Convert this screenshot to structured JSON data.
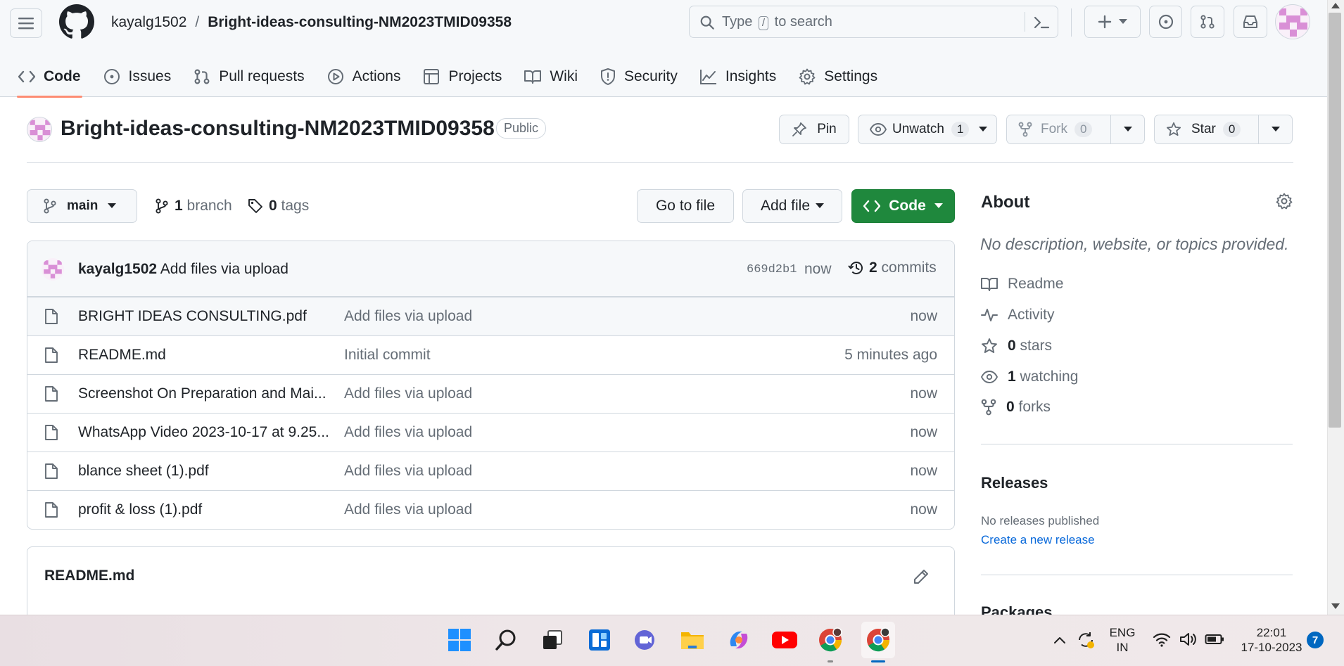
{
  "header": {
    "owner": "kayalg1502",
    "separator": "/",
    "repo": "Bright-ideas-consulting-NM2023TMID09358",
    "search_prefix": "Type",
    "search_key": "/",
    "search_suffix": "to search"
  },
  "tabs": [
    {
      "label": "Code",
      "icon": "code-icon",
      "selected": true
    },
    {
      "label": "Issues",
      "icon": "issue-icon"
    },
    {
      "label": "Pull requests",
      "icon": "pull-request-icon"
    },
    {
      "label": "Actions",
      "icon": "play-icon"
    },
    {
      "label": "Projects",
      "icon": "table-icon"
    },
    {
      "label": "Wiki",
      "icon": "book-icon"
    },
    {
      "label": "Security",
      "icon": "shield-icon"
    },
    {
      "label": "Insights",
      "icon": "graph-icon"
    },
    {
      "label": "Settings",
      "icon": "gear-icon"
    }
  ],
  "repo_header": {
    "title": "Bright-ideas-consulting-NM2023TMID09358",
    "visibility": "Public",
    "pin_label": "Pin",
    "watch_label": "Unwatch",
    "watch_count": "1",
    "fork_label": "Fork",
    "fork_count": "0",
    "star_label": "Star",
    "star_count": "0"
  },
  "toolbar": {
    "branch": "main",
    "branch_count": "1",
    "branch_word": "branch",
    "tag_count": "0",
    "tag_word": "tags",
    "goto_label": "Go to file",
    "add_file_label": "Add file",
    "code_label": "Code"
  },
  "commit": {
    "author": "kayalg1502",
    "message": "Add files via upload",
    "sha": "669d2b1",
    "time": "now",
    "commit_count": "2",
    "commit_word": "commits"
  },
  "files": [
    {
      "name": "BRIGHT IDEAS CONSULTING.pdf",
      "message": "Add files via upload",
      "time": "now"
    },
    {
      "name": "README.md",
      "message": "Initial commit",
      "time": "5 minutes ago"
    },
    {
      "name": "Screenshot On Preparation and Mai...",
      "message": "Add files via upload",
      "time": "now"
    },
    {
      "name": "WhatsApp Video 2023-10-17 at 9.25...",
      "message": "Add files via upload",
      "time": "now"
    },
    {
      "name": "blance sheet (1).pdf",
      "message": "Add files via upload",
      "time": "now"
    },
    {
      "name": "profit & loss (1).pdf",
      "message": "Add files via upload",
      "time": "now"
    }
  ],
  "readme": {
    "title": "README.md"
  },
  "about": {
    "heading": "About",
    "description": "No description, website, or topics provided.",
    "readme_label": "Readme",
    "activity_label": "Activity",
    "stars_count": "0",
    "stars_word": "stars",
    "watching_count": "1",
    "watching_word": "watching",
    "forks_count": "0",
    "forks_word": "forks"
  },
  "releases": {
    "heading": "Releases",
    "none_text": "No releases published",
    "create_link": "Create a new release"
  },
  "packages": {
    "heading": "Packages"
  },
  "taskbar": {
    "lang_top": "ENG",
    "lang_bottom": "IN",
    "time": "22:01",
    "date": "17-10-2023",
    "notification_count": "7"
  },
  "colors": {
    "accent_green": "#1f883d",
    "link_blue": "#0969da",
    "tab_underline": "#fd8c73",
    "muted_text": "#656d76"
  }
}
